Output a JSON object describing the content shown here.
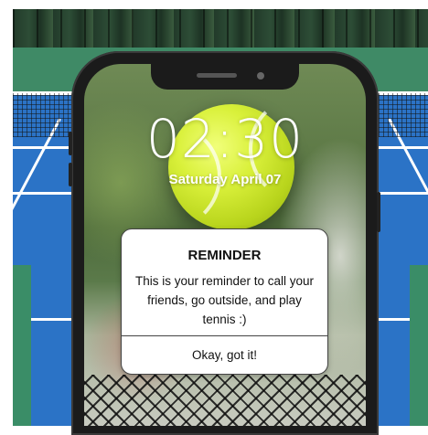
{
  "lock_screen": {
    "time": "02:30",
    "date": "Saturday April 07"
  },
  "dialog": {
    "title": "REMINDER",
    "message": "This is your reminder to call your friends, go outside, and play tennis :)",
    "button_label": "Okay, got it!"
  },
  "colors": {
    "court": "#2b73c6",
    "ball": "#d9f03a",
    "phone_frame": "#1b1b1b",
    "dialog_background": "#ffffff"
  }
}
